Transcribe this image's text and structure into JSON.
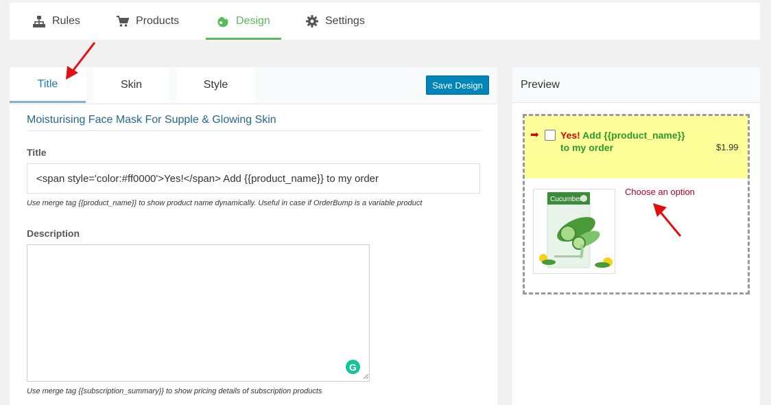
{
  "nav": {
    "items": [
      {
        "label": "Rules",
        "icon": "sitemap-icon"
      },
      {
        "label": "Products",
        "icon": "cart-icon"
      },
      {
        "label": "Design",
        "icon": "palette-icon",
        "active": true
      },
      {
        "label": "Settings",
        "icon": "gear-icon"
      }
    ]
  },
  "editor": {
    "tabs": [
      {
        "label": "Title",
        "active": true
      },
      {
        "label": "Skin"
      },
      {
        "label": "Style"
      }
    ],
    "save_label": "Save Design",
    "product_name": "Moisturising Face Mask For Supple & Glowing Skin",
    "title_label": "Title",
    "title_value": "<span style='color:#ff0000'>Yes!</span> Add {{product_name}} to my order",
    "title_hint": "Use merge tag {{product_name}} to show product name dynamically. Useful in case if OrderBump is a variable product",
    "description_label": "Description",
    "description_value": "",
    "description_hint": "Use merge tag {{subscription_summary}} to show pricing details of subscription products"
  },
  "preview": {
    "heading": "Preview",
    "bump_yes": "Yes!",
    "bump_rest": " Add {{product_name}} to my order",
    "price": "$1.99",
    "choose_option": "Choose an option",
    "product_image_text": "Cucumber"
  },
  "colors": {
    "accent_green": "#5cb85c",
    "save_button": "#0085ba",
    "bump_background": "#ffff99",
    "yes_red": "#e00000",
    "bump_green": "#2b9a2b"
  }
}
